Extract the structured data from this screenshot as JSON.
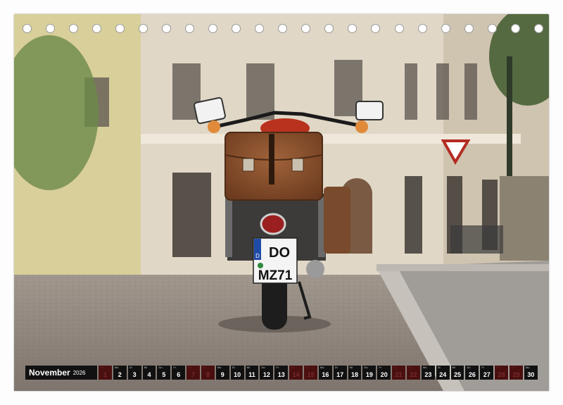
{
  "calendar": {
    "month": "November",
    "year": "2026",
    "days": [
      {
        "wd": "So",
        "n": "1",
        "red": true
      },
      {
        "wd": "Mo",
        "n": "2",
        "red": false
      },
      {
        "wd": "Di",
        "n": "3",
        "red": false
      },
      {
        "wd": "Mi",
        "n": "4",
        "red": false
      },
      {
        "wd": "Do",
        "n": "5",
        "red": false
      },
      {
        "wd": "Fr",
        "n": "6",
        "red": false
      },
      {
        "wd": "Sa",
        "n": "7",
        "red": true
      },
      {
        "wd": "So",
        "n": "8",
        "red": true
      },
      {
        "wd": "Mo",
        "n": "9",
        "red": false
      },
      {
        "wd": "Di",
        "n": "10",
        "red": false
      },
      {
        "wd": "Mi",
        "n": "11",
        "red": false
      },
      {
        "wd": "Do",
        "n": "12",
        "red": false
      },
      {
        "wd": "Fr",
        "n": "13",
        "red": false
      },
      {
        "wd": "Sa",
        "n": "14",
        "red": true
      },
      {
        "wd": "So",
        "n": "15",
        "red": true
      },
      {
        "wd": "Mo",
        "n": "16",
        "red": false
      },
      {
        "wd": "Di",
        "n": "17",
        "red": false
      },
      {
        "wd": "Mi",
        "n": "18",
        "red": false
      },
      {
        "wd": "Do",
        "n": "19",
        "red": false
      },
      {
        "wd": "Fr",
        "n": "20",
        "red": false
      },
      {
        "wd": "Sa",
        "n": "21",
        "red": true
      },
      {
        "wd": "So",
        "n": "22",
        "red": true
      },
      {
        "wd": "Mo",
        "n": "23",
        "red": false
      },
      {
        "wd": "Di",
        "n": "24",
        "red": false
      },
      {
        "wd": "Mi",
        "n": "25",
        "red": false
      },
      {
        "wd": "Do",
        "n": "26",
        "red": false
      },
      {
        "wd": "Fr",
        "n": "27",
        "red": false
      },
      {
        "wd": "Sa",
        "n": "28",
        "red": true
      },
      {
        "wd": "So",
        "n": "29",
        "red": true
      },
      {
        "wd": "Mo",
        "n": "30",
        "red": false
      }
    ]
  },
  "photo": {
    "plate_country": "D",
    "plate_line1": "DO",
    "plate_line2": "MZ71",
    "colors": {
      "cobble": "#8e857e",
      "facade": "#d9d0c0",
      "leather": "#8a5230",
      "tank": "#b8321e"
    }
  },
  "binding": {
    "hole_count": 23
  }
}
